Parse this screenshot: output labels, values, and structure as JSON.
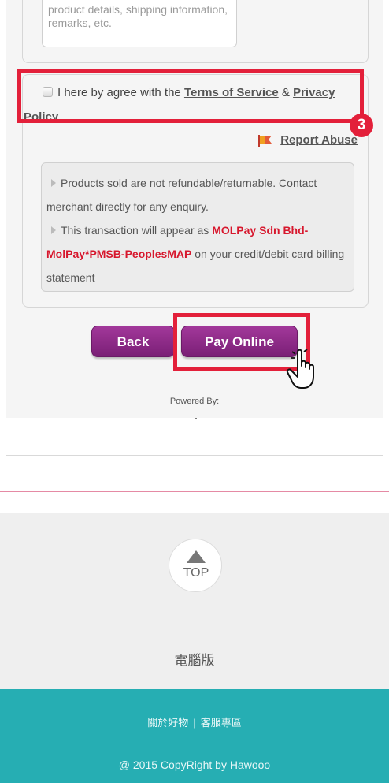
{
  "notes": {
    "placeholder_tail": "product details, shipping information, remarks, etc."
  },
  "agreement": {
    "prefix": "I here by agree with the",
    "terms_link": "Terms of Service",
    "amp": "&",
    "privacy_link": "Privacy",
    "policy_link": "Policy"
  },
  "annotation": {
    "step_number": "3",
    "highlight_color": "#e3203a"
  },
  "report": {
    "label": "Report Abuse",
    "icon": "flag-icon"
  },
  "notice": {
    "line1": "Products sold are not refundable/returnable. Contact",
    "line2": "merchant directly for any enquiry.",
    "line3_prefix": "This transaction will appear as",
    "line3_red": "MOLPay Sdn Bhd-",
    "line4_red": "MolPay*PMSB-PeoplesMAP",
    "line4_suffix": "on your credit/debit card billing",
    "line5": "statement"
  },
  "buttons": {
    "back": "Back",
    "pay_online": "Pay Online",
    "accent": "#7a1f76"
  },
  "powered_by": "Powered By:",
  "top_button": {
    "label": "TOP",
    "icon": "arrow-up-icon"
  },
  "desktop_version": "電腦版",
  "footer": {
    "about": "關於好物",
    "separator": "|",
    "support": "客服專區",
    "copyright": "@ 2015 CopyRight by Hawooo",
    "bg_color": "#26aeb3"
  }
}
